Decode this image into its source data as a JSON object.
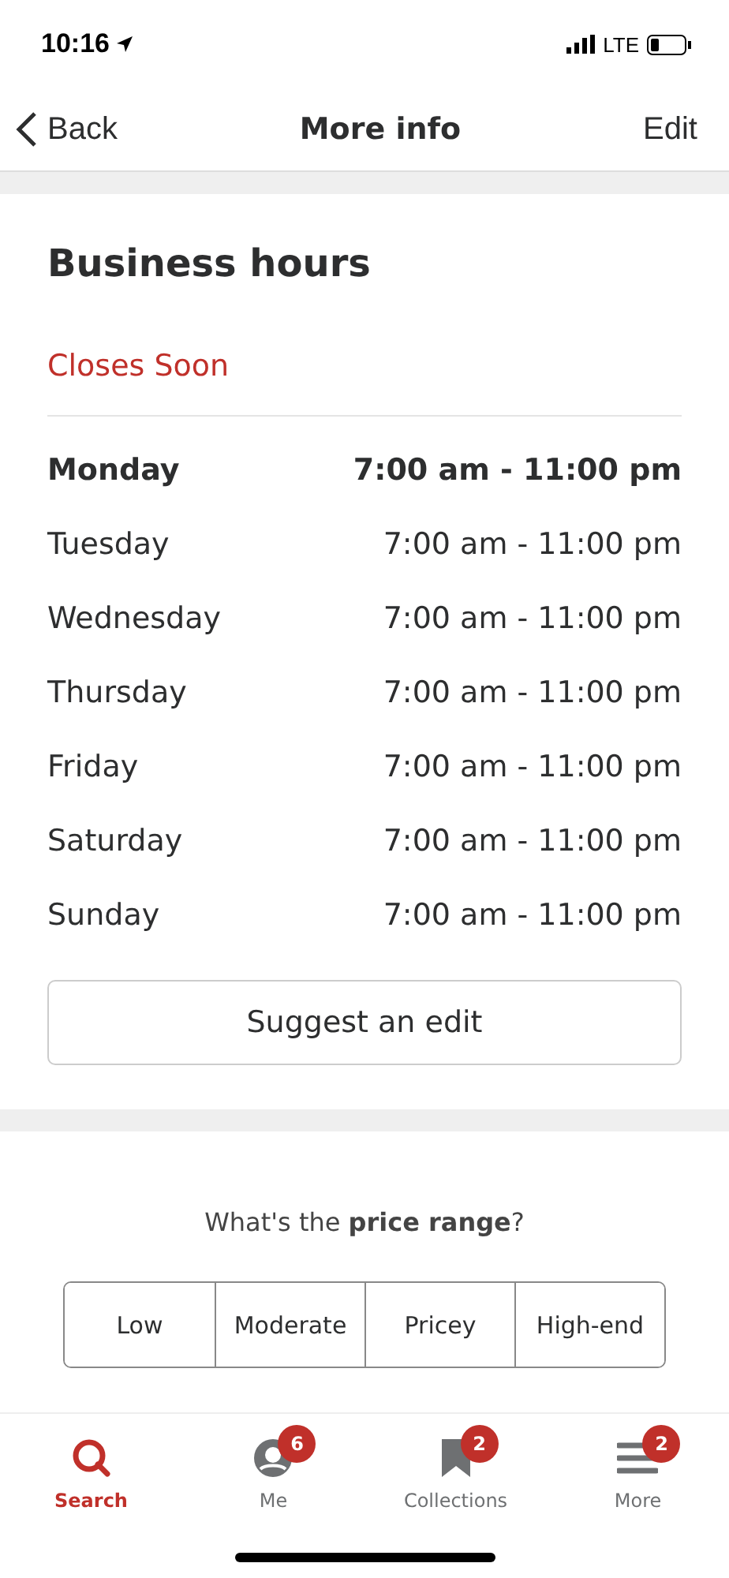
{
  "status_bar": {
    "time": "10:16",
    "network": "LTE"
  },
  "nav": {
    "back": "Back",
    "title": "More info",
    "action": "Edit"
  },
  "hours": {
    "title": "Business hours",
    "status": "Closes Soon",
    "days": [
      {
        "day": "Monday",
        "hours": "7:00 am - 11:00 pm",
        "today": true
      },
      {
        "day": "Tuesday",
        "hours": "7:00 am - 11:00 pm",
        "today": false
      },
      {
        "day": "Wednesday",
        "hours": "7:00 am - 11:00 pm",
        "today": false
      },
      {
        "day": "Thursday",
        "hours": "7:00 am - 11:00 pm",
        "today": false
      },
      {
        "day": "Friday",
        "hours": "7:00 am - 11:00 pm",
        "today": false
      },
      {
        "day": "Saturday",
        "hours": "7:00 am - 11:00 pm",
        "today": false
      },
      {
        "day": "Sunday",
        "hours": "7:00 am - 11:00 pm",
        "today": false
      }
    ],
    "button": "Suggest an edit"
  },
  "price": {
    "question": "What's the **price range**?",
    "options": [
      {
        "label": "Low",
        "selected": false
      },
      {
        "label": "Moderate",
        "selected": false
      },
      {
        "label": "Pricey",
        "selected": false
      },
      {
        "label": "High-end",
        "selected": false
      }
    ]
  },
  "tab_bar": [
    {
      "kind": "search",
      "label": "Search",
      "selected": true
    },
    {
      "kind": "me",
      "label": "Me",
      "badge": "6",
      "selected": false
    },
    {
      "kind": "collections",
      "label": "Collections",
      "badge": "2",
      "selected": false
    },
    {
      "kind": "more",
      "label": "More",
      "badge": "2",
      "selected": false
    }
  ]
}
